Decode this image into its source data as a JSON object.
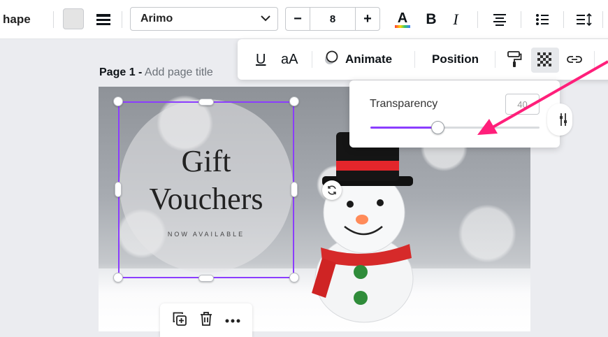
{
  "toolbar": {
    "shape_label": "hape",
    "font_family": "Arimo",
    "font_size": "8",
    "decrease": "−",
    "increase": "+",
    "bold": "B",
    "italic": "I",
    "swatch_color": "#e4e4e4"
  },
  "float_toolbar": {
    "underline": "U",
    "case": "aA",
    "animate": "Animate",
    "position": "Position"
  },
  "page": {
    "title_prefix": "Page 1 -",
    "title_placeholder": "Add page title"
  },
  "design": {
    "line1": "Gift",
    "line2": "Vouchers",
    "subline": "NOW AVAILABLE"
  },
  "transparency": {
    "label": "Transparency",
    "value_text": "40",
    "level_percent": 40,
    "accent": "#8b3dff"
  },
  "annotation": {
    "arrow_color": "#ff1f7a"
  }
}
